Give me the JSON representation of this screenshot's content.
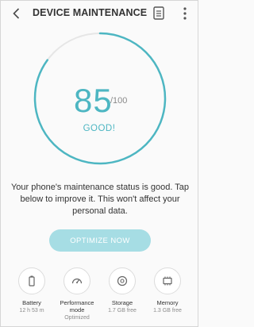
{
  "header": {
    "title": "DEVICE MAINTENANCE"
  },
  "score": {
    "value": "85",
    "max": "/100",
    "status": "GOOD!",
    "level": 0.85
  },
  "message": "Your phone's maintenance status is good. Tap below to improve it. This won't affect your personal data.",
  "optimize_button": "OPTIMIZE NOW",
  "tools": [
    {
      "label": "Battery",
      "value": "12 h 53 m",
      "icon": "battery-icon"
    },
    {
      "label": "Performance mode",
      "value": "Optimized",
      "icon": "speedometer-icon"
    },
    {
      "label": "Storage",
      "value": "1.7 GB free",
      "icon": "storage-icon"
    },
    {
      "label": "Memory",
      "value": "1.3 GB free",
      "icon": "memory-icon"
    }
  ],
  "colors": {
    "accent": "#4db6c2",
    "button": "#a6dde4",
    "track": "#e6e6e6"
  }
}
